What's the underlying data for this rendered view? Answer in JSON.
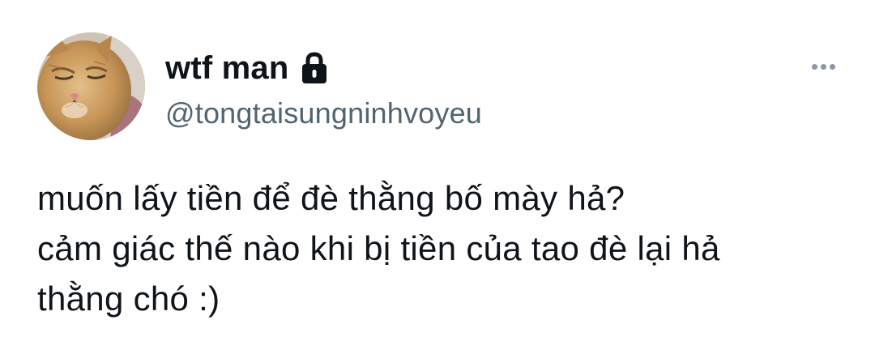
{
  "user": {
    "display_name": "wtf man",
    "handle": "@tongtaisungninhvoyeu",
    "avatar_icon": "cat-avatar",
    "protected_icon": "lock-icon"
  },
  "actions": {
    "more_icon": "more-horizontal-icon"
  },
  "tweet": {
    "lines": [
      "muốn lấy tiền để đè thằng bố mày hả?",
      "cảm giác thế nào khi bị tiền của tao đè lại hả",
      "thằng chó :)"
    ]
  },
  "colors": {
    "text_primary": "#0f1419",
    "text_secondary": "#536471",
    "more_dots": "#8b98a5",
    "background": "#ffffff"
  }
}
